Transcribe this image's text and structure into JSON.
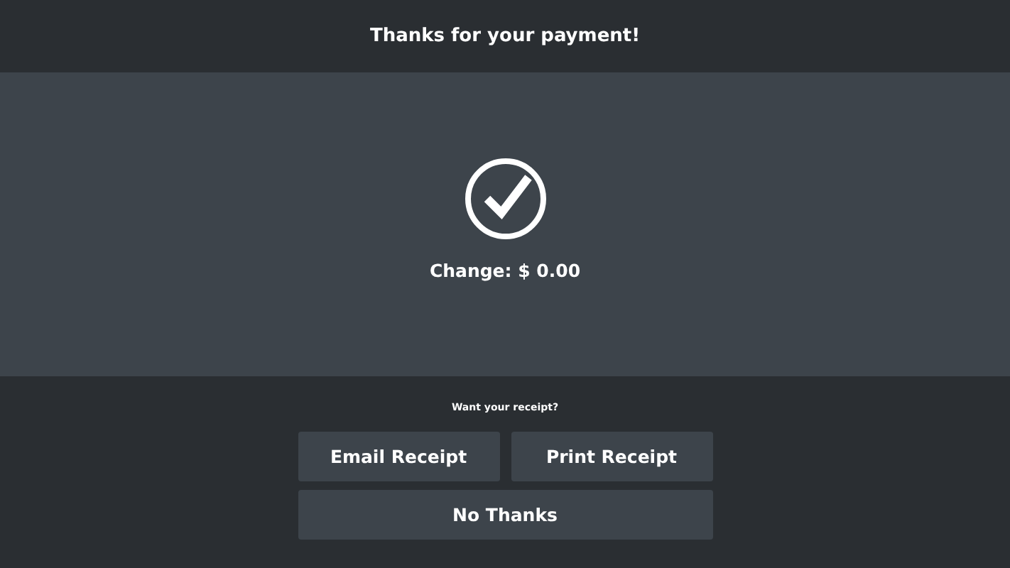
{
  "header": {
    "title": "Thanks for your payment!"
  },
  "result": {
    "change": "Change: $ 0.00"
  },
  "receipt": {
    "prompt": "Want your receipt?",
    "buttons": [
      {
        "label": "Email Receipt"
      },
      {
        "label": "Print Receipt"
      },
      {
        "label": "No Thanks"
      }
    ]
  }
}
